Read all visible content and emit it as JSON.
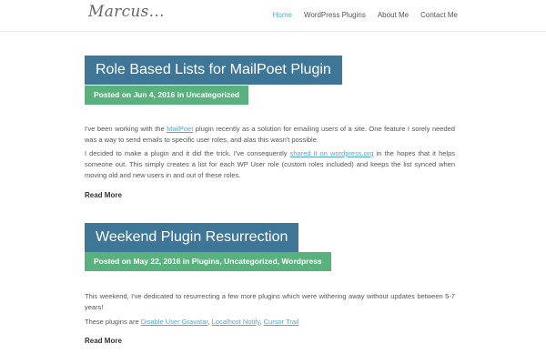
{
  "site": {
    "logo": "Marcus...",
    "nav": [
      "Home",
      "WordPress Plugins",
      "About Me",
      "Contact Me"
    ]
  },
  "posts": [
    {
      "title": "Role Based Lists for MailPoet Plugin",
      "meta": "Posted on Jun 4, 2016 in Uncategorized",
      "p1": {
        "a": "I've been working with the ",
        "link": "MailPoet",
        "b": " plugin recently as a solution for emailing users of a site. One feature I sorely needed was a way to send emails to specific user roles, and alas this wasn't possible."
      },
      "p2": {
        "a": "I decided to make a plugin and it did the trick. I've consequently ",
        "link": "shared it on wordpress.org",
        "b": " in the hopes that it helps someone out. This simply creates a list for each WP User role (custom roles included) and keeps the list synced when moving old and new users in and out of these roles."
      },
      "read_more": "Read More"
    },
    {
      "title": "Weekend Plugin Resurrection",
      "meta": "Posted on May 22, 2016 in Plugins, Uncategorized, Wordpress",
      "p1": "This weekend, I've dedicated to resurrecting a few more plugins which were withering away without updates between 5-7 years!",
      "p2": {
        "a": "These plugins are ",
        "l1": "Disable User Gravatar",
        "s1": ", ",
        "l2": "Localhost Notify",
        "s2": ", ",
        "l3": "Cursor Trail"
      },
      "read_more": "Read More"
    }
  ]
}
